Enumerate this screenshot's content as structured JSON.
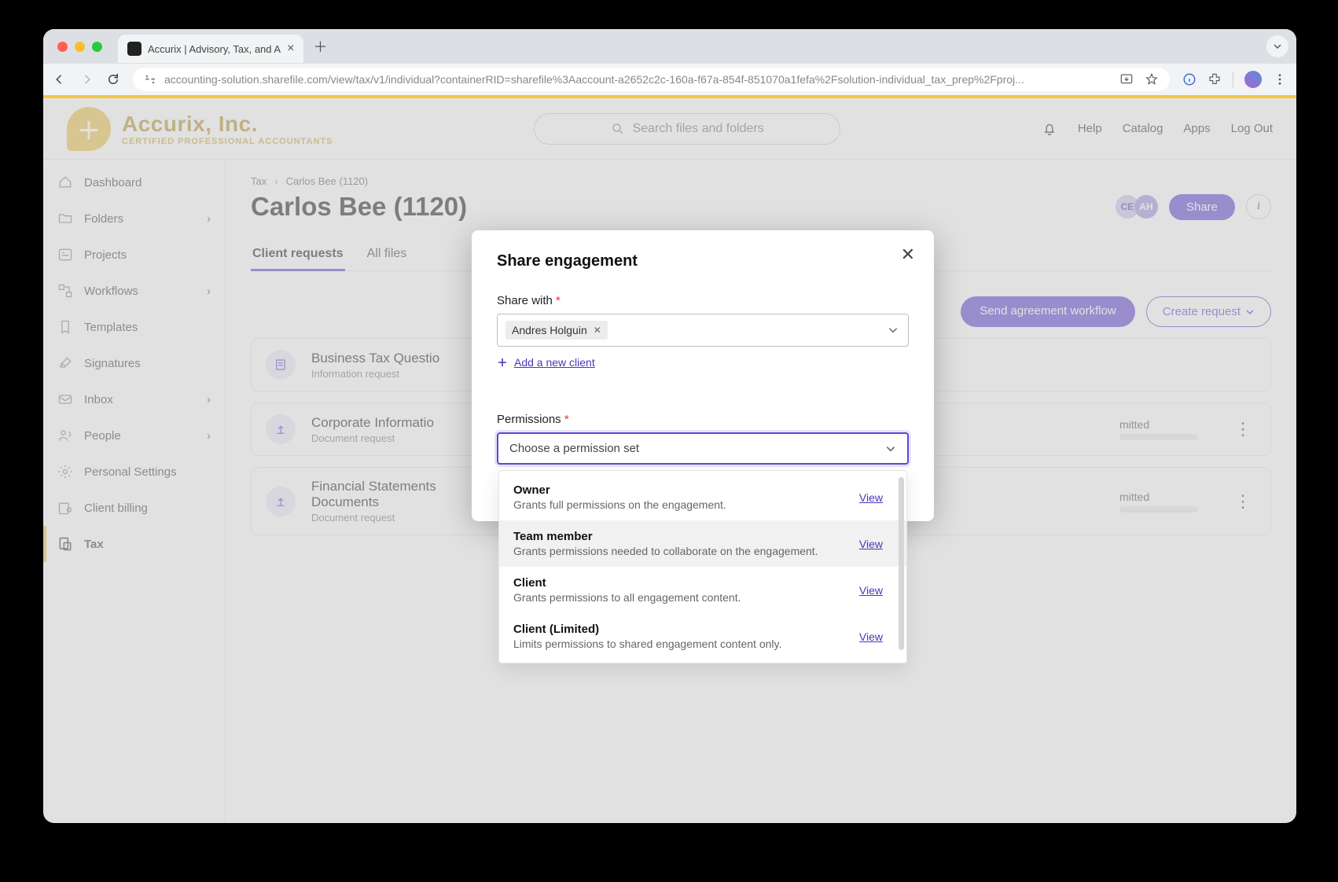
{
  "browser": {
    "tab_title": "Accurix | Advisory, Tax, and A",
    "url": "accounting-solution.sharefile.com/view/tax/v1/individual?containerRID=sharefile%3Aaccount-a2652c2c-160a-f67a-854f-851070a1fefa%2Fsolution-individual_tax_prep%2Fproj..."
  },
  "header": {
    "brand": "Accurix, Inc.",
    "tagline": "CERTIFIED PROFESSIONAL ACCOUNTANTS",
    "search_placeholder": "Search files and folders",
    "links": {
      "help": "Help",
      "catalog": "Catalog",
      "apps": "Apps",
      "logout": "Log Out"
    }
  },
  "sidebar": {
    "items": [
      {
        "label": "Dashboard",
        "chevron": false
      },
      {
        "label": "Folders",
        "chevron": true
      },
      {
        "label": "Projects",
        "chevron": false
      },
      {
        "label": "Workflows",
        "chevron": true
      },
      {
        "label": "Templates",
        "chevron": false
      },
      {
        "label": "Signatures",
        "chevron": false
      },
      {
        "label": "Inbox",
        "chevron": true
      },
      {
        "label": "People",
        "chevron": true
      },
      {
        "label": "Personal Settings",
        "chevron": false
      },
      {
        "label": "Client billing",
        "chevron": false
      },
      {
        "label": "Tax",
        "chevron": false,
        "active": true
      }
    ]
  },
  "breadcrumbs": {
    "a": "Tax",
    "b": "Carlos Bee (1120)"
  },
  "page": {
    "title": "Carlos Bee (1120)",
    "share_label": "Share",
    "avatars": {
      "a1": "CE",
      "a2": "AH"
    },
    "tabs": {
      "active": "Client requests",
      "other": "All files"
    },
    "actions": {
      "send_workflow": "Send agreement workflow",
      "create_request": "Create request"
    },
    "requests": [
      {
        "title": "Business Tax Questio",
        "sub": "Information request",
        "status": ""
      },
      {
        "title": "Corporate Informatio",
        "sub": "Document request",
        "status": "mitted"
      },
      {
        "title": "Financial Statements\nDocuments",
        "sub": "Document request",
        "status": "mitted"
      }
    ]
  },
  "dialog": {
    "title": "Share engagement",
    "share_with_label": "Share with",
    "chip_name": "Andres Holguin",
    "add_client": "Add a new client",
    "perm_label": "Permissions",
    "perm_placeholder": "Choose a permission set",
    "options": [
      {
        "name": "Owner",
        "desc": "Grants full permissions on the engagement.",
        "view": "View"
      },
      {
        "name": "Team member",
        "desc": "Grants permissions needed to collaborate on the engagement.",
        "view": "View",
        "hover": true
      },
      {
        "name": "Client",
        "desc": "Grants permissions to all engagement content.",
        "view": "View"
      },
      {
        "name": "Client (Limited)",
        "desc": "Limits permissions to shared engagement content only.",
        "view": "View"
      }
    ]
  }
}
